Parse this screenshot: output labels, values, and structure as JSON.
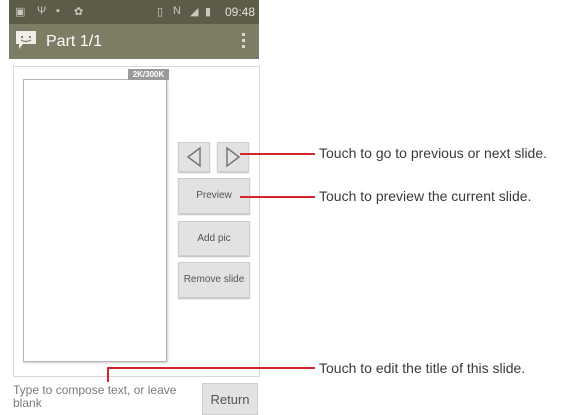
{
  "status_bar": {
    "time": "09:48",
    "icons": [
      "picture-icon",
      "usb-icon",
      "sd-card-icon",
      "android-icon",
      "vibrate-icon",
      "nfc-icon",
      "signal-icon",
      "battery-icon"
    ]
  },
  "action_bar": {
    "title": "Part 1/1",
    "app_icon": "message-icon",
    "menu_icon": "overflow-menu-icon"
  },
  "slide": {
    "size_badge": "2K/300K"
  },
  "buttons": {
    "previous_icon": "triangle-left-icon",
    "next_icon": "triangle-right-icon",
    "preview": "Preview",
    "add_pic": "Add pic",
    "remove_slide": "Remove slide"
  },
  "compose": {
    "placeholder": "Type to compose text, or leave blank",
    "return_label": "Return"
  },
  "callouts": [
    {
      "text": "Touch to go to previous or next slide."
    },
    {
      "text": "Touch to preview the current slide."
    },
    {
      "text": "Touch to edit the title of this slide."
    }
  ],
  "colors": {
    "status_bar": "#5d5c48",
    "action_bar": "#7d7c65",
    "callout_line": "#d1252a"
  }
}
